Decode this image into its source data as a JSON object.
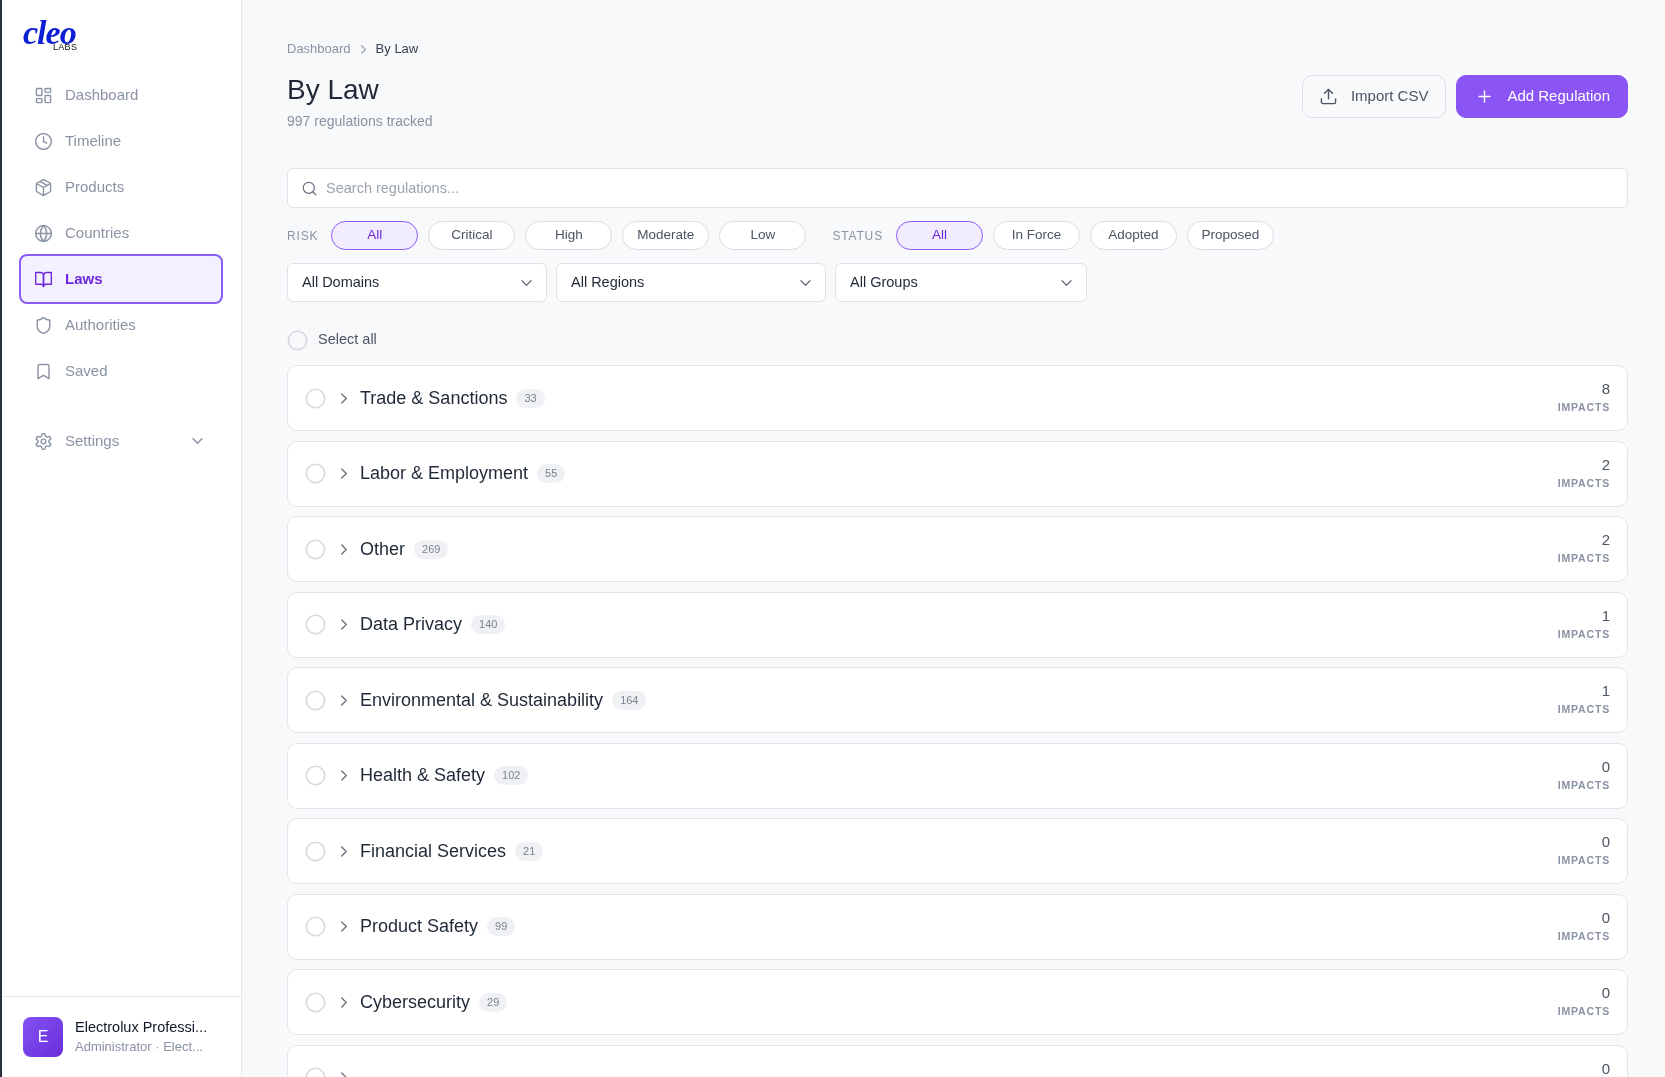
{
  "sidebar": {
    "logo": {
      "word": "cleo",
      "tag": "LABS"
    },
    "items": [
      {
        "label": "Dashboard",
        "selected": false
      },
      {
        "label": "Timeline",
        "selected": false
      },
      {
        "label": "Products",
        "selected": false
      },
      {
        "label": "Countries",
        "selected": false
      },
      {
        "label": "Laws",
        "selected": true
      },
      {
        "label": "Authorities",
        "selected": false
      },
      {
        "label": "Saved",
        "selected": false
      }
    ],
    "settings": {
      "label": "Settings",
      "expanded": false
    },
    "user": {
      "initial": "E",
      "name": "Electrolux Professi...",
      "role": "Administrator · Elect..."
    }
  },
  "breadcrumbs": [
    {
      "label": "Dashboard"
    },
    {
      "label": "By Law"
    }
  ],
  "header": {
    "title": "By Law",
    "subtitle": "997 regulations tracked"
  },
  "actions": [
    {
      "label": "Import CSV",
      "kind": "import"
    },
    {
      "label": "Add Regulation",
      "kind": "add"
    }
  ],
  "search": {
    "placeholder": "Search regulations..."
  },
  "filters": [
    {
      "label": "RISK",
      "options": [
        {
          "label": "All",
          "selected": true
        },
        {
          "label": "Critical",
          "selected": false
        },
        {
          "label": "High",
          "selected": false
        },
        {
          "label": "Moderate",
          "selected": false
        },
        {
          "label": "Low",
          "selected": false
        }
      ]
    },
    {
      "label": "STATUS",
      "options": [
        {
          "label": "All",
          "selected": true
        },
        {
          "label": "In Force",
          "selected": false
        },
        {
          "label": "Adopted",
          "selected": false
        },
        {
          "label": "Proposed",
          "selected": false
        }
      ]
    }
  ],
  "dropdowns": [
    {
      "value": "All Domains"
    },
    {
      "value": "All Regions"
    },
    {
      "value": "All Groups"
    }
  ],
  "select_all": {
    "label": "Select all",
    "checked": false
  },
  "groups": [
    {
      "name": "Trade & Sanctions",
      "count": "33",
      "impacts": "8",
      "impacts_label": "IMPACTS",
      "checked": false,
      "expanded": false
    },
    {
      "name": "Labor & Employment",
      "count": "55",
      "impacts": "2",
      "impacts_label": "IMPACTS",
      "checked": false,
      "expanded": false
    },
    {
      "name": "Other",
      "count": "269",
      "impacts": "2",
      "impacts_label": "IMPACTS",
      "checked": false,
      "expanded": false
    },
    {
      "name": "Data Privacy",
      "count": "140",
      "impacts": "1",
      "impacts_label": "IMPACTS",
      "checked": false,
      "expanded": false
    },
    {
      "name": "Environmental & Sustainability",
      "count": "164",
      "impacts": "1",
      "impacts_label": "IMPACTS",
      "checked": false,
      "expanded": false
    },
    {
      "name": "Health & Safety",
      "count": "102",
      "impacts": "0",
      "impacts_label": "IMPACTS",
      "checked": false,
      "expanded": false
    },
    {
      "name": "Financial Services",
      "count": "21",
      "impacts": "0",
      "impacts_label": "IMPACTS",
      "checked": false,
      "expanded": false
    },
    {
      "name": "Product Safety",
      "count": "99",
      "impacts": "0",
      "impacts_label": "IMPACTS",
      "checked": false,
      "expanded": false
    },
    {
      "name": "Cybersecurity",
      "count": "29",
      "impacts": "0",
      "impacts_label": "IMPACTS",
      "checked": false,
      "expanded": false
    },
    {
      "impacts": "0",
      "checked": false,
      "expanded": false
    }
  ]
}
